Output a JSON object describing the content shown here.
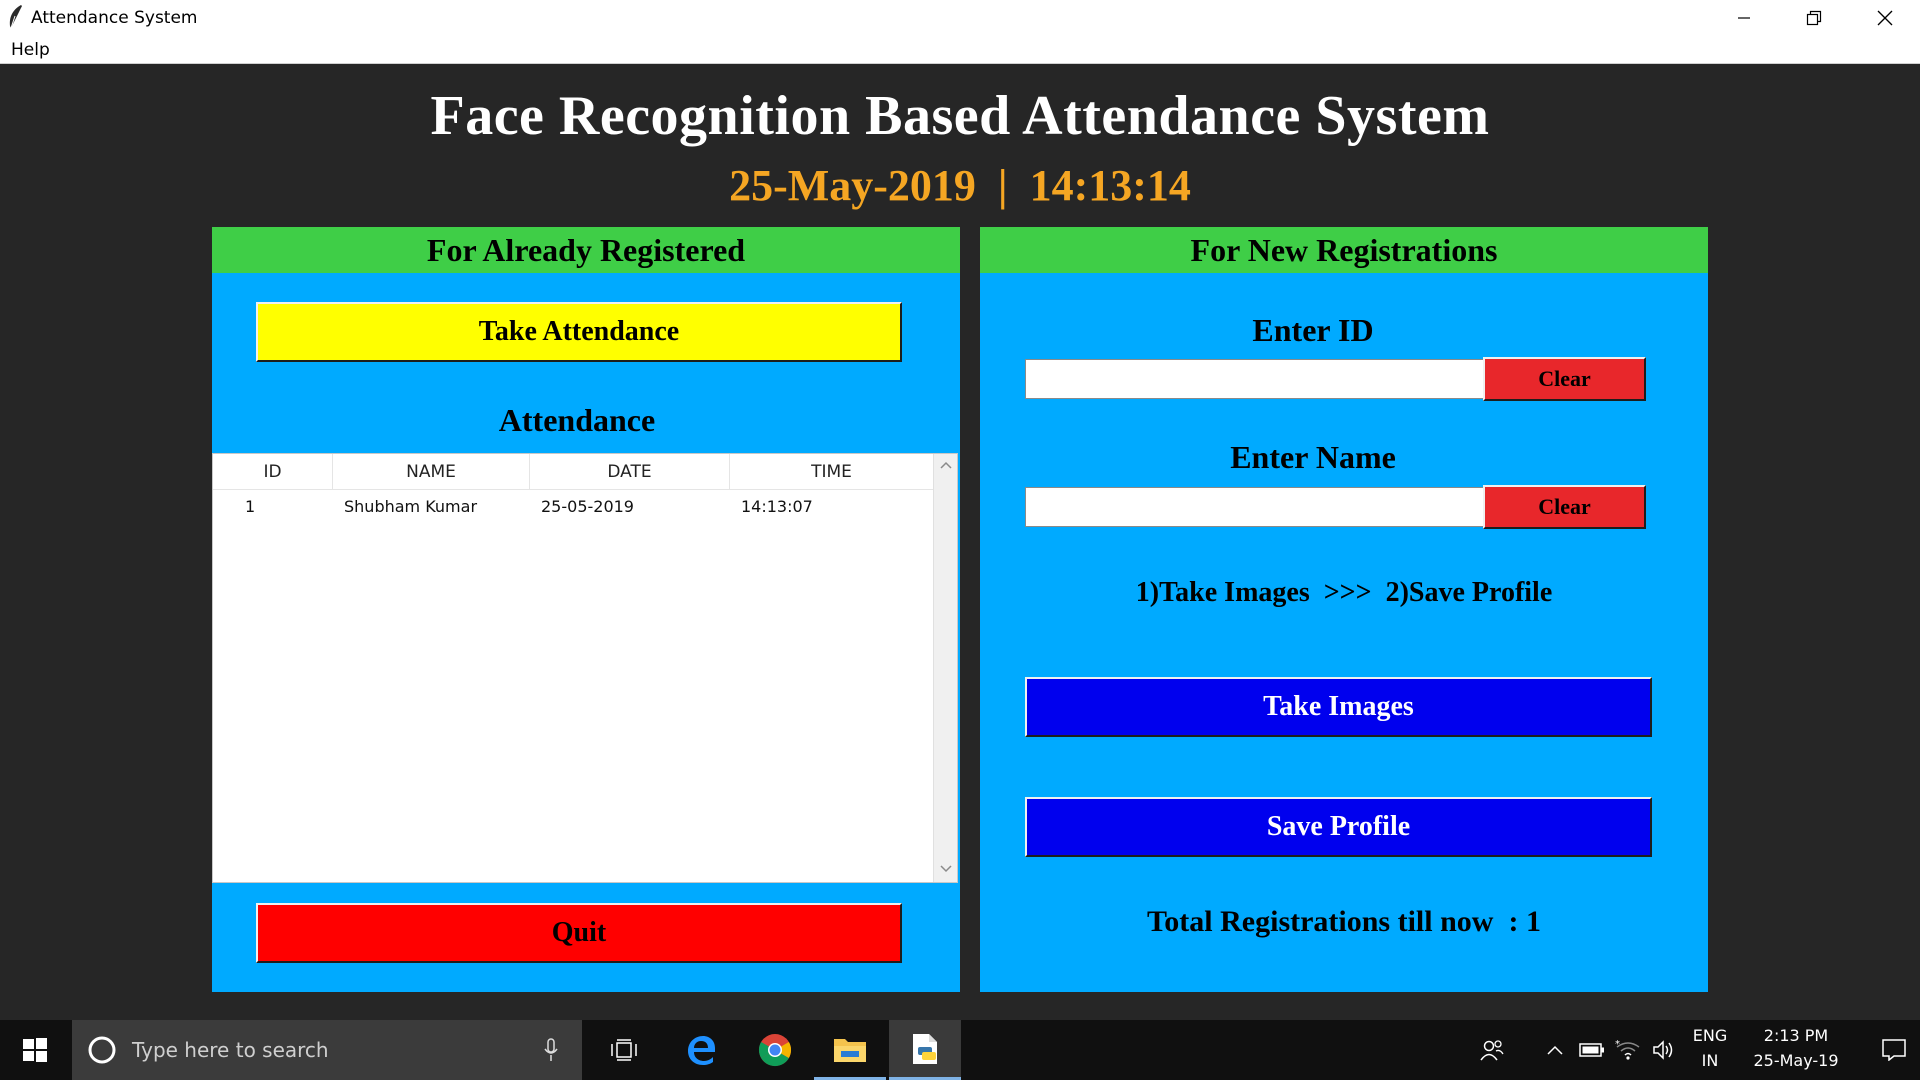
{
  "window": {
    "title": "Attendance System",
    "controls": {
      "minimize": "minimize-icon",
      "maximize": "restore-icon",
      "close": "close-icon"
    }
  },
  "menu": {
    "items": [
      "Help"
    ]
  },
  "header": {
    "title": "Face Recognition Based Attendance System",
    "date": "25-May-2019",
    "separator": "|",
    "time": "14:13:14"
  },
  "left_panel": {
    "title": "For Already Registered",
    "take_attendance_label": "Take Attendance",
    "attendance_title": "Attendance",
    "table": {
      "columns": [
        "ID",
        "NAME",
        "DATE",
        "TIME"
      ],
      "rows": [
        {
          "id": "1",
          "name": "Shubham Kumar",
          "date": "25-05-2019",
          "time": "14:13:07"
        }
      ]
    },
    "quit_label": "Quit"
  },
  "right_panel": {
    "title": "For New Registrations",
    "enter_id_label": "Enter ID",
    "id_value": "",
    "clear_id_label": "Clear",
    "enter_name_label": "Enter Name",
    "name_value": "",
    "clear_name_label": "Clear",
    "steps": "1)Take Images  >>>  2)Save Profile",
    "take_images_label": "Take Images",
    "save_profile_label": "Save Profile",
    "total_registrations": "Total Registrations till now  : 1"
  },
  "taskbar": {
    "search_placeholder": "Type here to search",
    "language_top": "ENG",
    "language_bottom": "IN",
    "clock_time": "2:13 PM",
    "clock_date": "25-May-19"
  },
  "colors": {
    "panel_bg": "#00aaff",
    "panel_header": "#3fce47",
    "take_attendance": "#ffff00",
    "quit": "#ff0000",
    "clear": "#e8272b",
    "primary_action": "#0000ee",
    "datetime": "#f5a623"
  }
}
